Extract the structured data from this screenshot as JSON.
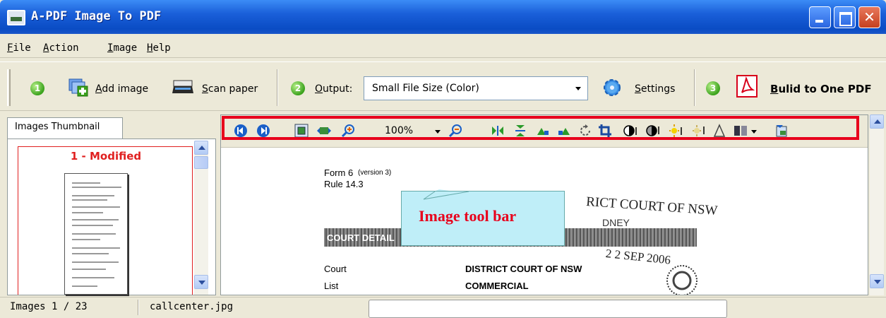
{
  "window": {
    "title": "A-PDF Image To PDF",
    "close_glyph": "✕"
  },
  "menu": [
    "File",
    "Action",
    "Image",
    "Help"
  ],
  "toolbar": {
    "steps": [
      "1",
      "2",
      "3"
    ],
    "add_image": "Add image",
    "scan_paper": "Scan paper",
    "output_label": "Output:",
    "output_value": "Small File Size (Color)",
    "settings": "Settings",
    "build": "Bulid to One PDF"
  },
  "panel": {
    "tab_label": "Images Thumbnail",
    "thumb_label": "1 - Modified"
  },
  "image_toolbar": {
    "zoom": "100%"
  },
  "document": {
    "form": "Form 6",
    "version": "(version 3)",
    "rule": "Rule 14.3",
    "court_header": "RICT COURT OF NSW",
    "sydney": "DNEY",
    "court_details": "COURT DETAIL",
    "date_stamp": "2 2 SEP 2006",
    "court_label": "Court",
    "court_value": "DISTRICT COURT OF NSW",
    "list_label": "List",
    "list_value": "COMMERCIAL"
  },
  "callout": {
    "text": "Image tool bar"
  },
  "status": {
    "images": "Images 1 / 23",
    "filename": "callcenter.jpg"
  },
  "colors": {
    "title_blue": "#0a4cc4",
    "highlight_red": "#e8001c",
    "callout_fill": "#bfeef8"
  }
}
